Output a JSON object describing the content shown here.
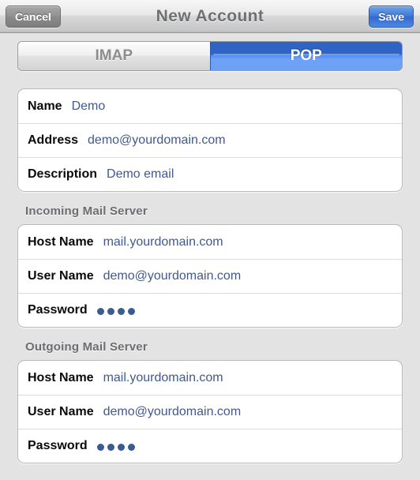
{
  "navbar": {
    "title": "New Account",
    "cancel_label": "Cancel",
    "save_label": "Save"
  },
  "segmented_control": {
    "options": [
      "IMAP",
      "POP"
    ],
    "imap_label": "IMAP",
    "pop_label": "POP",
    "selected": "POP"
  },
  "colors": {
    "accent_blue": "#3169cf",
    "selected_segment": "#2f63c4",
    "value_text": "#41598c",
    "label_text": "#0a0a0a",
    "section_header": "#6c6d70",
    "page_background": "#e3e3e3",
    "card_background": "#ffffff"
  },
  "account_section": {
    "rows": [
      {
        "label": "Name",
        "value": "Demo"
      },
      {
        "label": "Address",
        "value": "demo@yourdomain.com"
      },
      {
        "label": "Description",
        "value": "Demo email"
      }
    ]
  },
  "incoming_section": {
    "header": "Incoming Mail Server",
    "rows": [
      {
        "label": "Host Name",
        "value": "mail.yourdomain.com"
      },
      {
        "label": "User Name",
        "value": "demo@yourdomain.com"
      },
      {
        "label": "Password",
        "value": "••••",
        "masked": true,
        "dot_count": 4
      }
    ]
  },
  "outgoing_section": {
    "header": "Outgoing Mail Server",
    "rows": [
      {
        "label": "Host Name",
        "value": "mail.yourdomain.com"
      },
      {
        "label": "User Name",
        "value": "demo@yourdomain.com"
      },
      {
        "label": "Password",
        "value": "••••",
        "masked": true,
        "dot_count": 4
      }
    ]
  }
}
